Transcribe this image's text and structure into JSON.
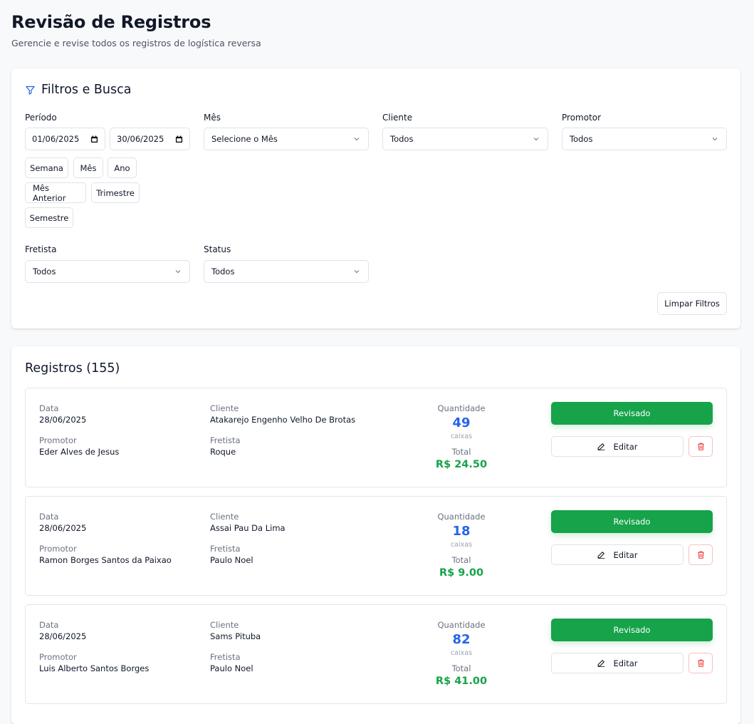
{
  "header": {
    "title": "Revisão de Registros",
    "subtitle": "Gerencie e revise todos os registros de logística reversa"
  },
  "filters": {
    "title": "Filtros e Busca",
    "period": {
      "label": "Período",
      "start_date": "01/06/2025",
      "end_date": "30/06/2025",
      "quick_buttons": [
        "Semana",
        "Mês",
        "Ano",
        "Mês Anterior",
        "Trimestre",
        "Semestre"
      ]
    },
    "month": {
      "label": "Mês",
      "value": "Selecione o Mês"
    },
    "client": {
      "label": "Cliente",
      "value": "Todos"
    },
    "promoter": {
      "label": "Promotor",
      "value": "Todos"
    },
    "carrier": {
      "label": "Fretista",
      "value": "Todos"
    },
    "status": {
      "label": "Status",
      "value": "Todos"
    },
    "clear_label": "Limpar Filtros"
  },
  "records": {
    "title": "Registros (155)",
    "labels": {
      "date": "Data",
      "client": "Cliente",
      "promoter": "Promotor",
      "carrier": "Fretista",
      "quantity": "Quantidade",
      "unit": "caixas",
      "total": "Total",
      "edit": "Editar"
    },
    "items": [
      {
        "date": "28/06/2025",
        "client": "Atakarejo Engenho Velho De Brotas",
        "promoter": "Eder Alves de Jesus",
        "carrier": "Roque",
        "quantity": "49",
        "total": "R$ 24.50",
        "status": "Revisado"
      },
      {
        "date": "28/06/2025",
        "client": "Assai Pau Da Lima",
        "promoter": "Ramon Borges Santos da Paixao",
        "carrier": "Paulo Noel",
        "quantity": "18",
        "total": "R$ 9.00",
        "status": "Revisado"
      },
      {
        "date": "28/06/2025",
        "client": "Sams Pituba",
        "promoter": "Luis Alberto Santos Borges",
        "carrier": "Paulo Noel",
        "quantity": "82",
        "total": "R$ 41.00",
        "status": "Revisado"
      }
    ]
  },
  "colors": {
    "accent_blue": "#2563eb",
    "status_green": "#16a34a",
    "danger_red": "#ef4444"
  }
}
